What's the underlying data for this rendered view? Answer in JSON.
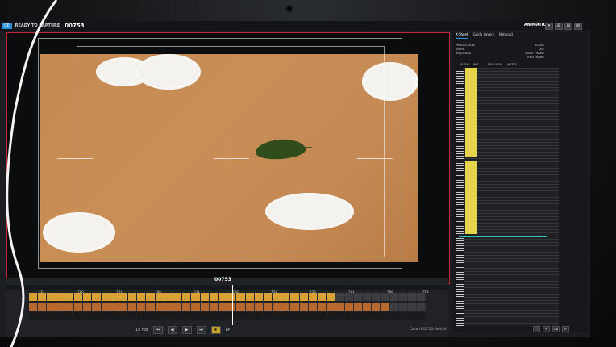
{
  "app": {
    "status_badge": "CE",
    "status": "READY TO CAPTURE",
    "frame_number": "00753",
    "mode": "ANIMATION",
    "mode_buttons": [
      "▾",
      "⊞",
      "▤",
      "▥"
    ]
  },
  "xsheet": {
    "tabs": [
      "X-Sheet",
      "Guide Layers",
      "Notepad"
    ],
    "active_tab": "X-Sheet",
    "info": [
      {
        "label": "PRODUCTION",
        "value": "SCENE"
      },
      {
        "label": "Scene",
        "value": "001"
      },
      {
        "label": "SEQUENCE",
        "value": "START FRAME"
      },
      {
        "label": "",
        "value": "END FRAME"
      }
    ],
    "column_headers": [
      "AUDIO",
      "IMG",
      "DIALOGUE",
      "NOTES"
    ],
    "tools": [
      "⬛",
      "✎",
      "⌫",
      "✐"
    ]
  },
  "timeline": {
    "frame_display": "00753",
    "ruler_labels": [
      "721",
      "726",
      "731",
      "736",
      "741",
      "746",
      "751",
      "756",
      "761",
      "766",
      "771"
    ],
    "transport": {
      "fps": "15 fps",
      "buttons": [
        "⏮",
        "◀",
        "▶",
        "⏭",
        "⏺"
      ],
      "active_index": 4,
      "loop_label": "LP"
    },
    "camera_label": "Canon EOS 5D Mark IV"
  },
  "colors": {
    "accent": "#c0283a",
    "highlight": "#d7a233",
    "thumb": "#b8682c",
    "teal": "#3ac1c1",
    "badge": "#2c8fd8"
  }
}
